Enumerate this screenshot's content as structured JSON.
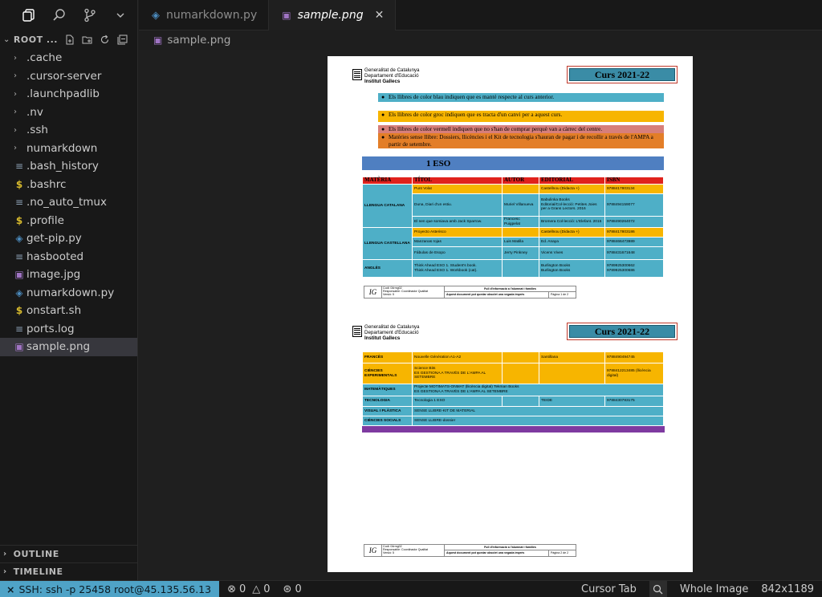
{
  "activity": {
    "icons": [
      "files-icon",
      "search-icon",
      "source-control-icon",
      "chevron-down-icon"
    ]
  },
  "explorer": {
    "title": "ROOT ...",
    "items": [
      {
        "name": ".cache",
        "type": "folder"
      },
      {
        "name": ".cursor-server",
        "type": "folder"
      },
      {
        "name": ".launchpadlib",
        "type": "folder"
      },
      {
        "name": ".nv",
        "type": "folder"
      },
      {
        "name": ".ssh",
        "type": "folder"
      },
      {
        "name": "numarkdown",
        "type": "folder"
      },
      {
        "name": ".bash_history",
        "type": "lines"
      },
      {
        "name": ".bashrc",
        "type": "dollar"
      },
      {
        "name": ".no_auto_tmux",
        "type": "lines"
      },
      {
        "name": ".profile",
        "type": "dollar"
      },
      {
        "name": "get-pip.py",
        "type": "python"
      },
      {
        "name": "hasbooted",
        "type": "lines"
      },
      {
        "name": "image.jpg",
        "type": "img"
      },
      {
        "name": "numarkdown.py",
        "type": "python"
      },
      {
        "name": "onstart.sh",
        "type": "dollar"
      },
      {
        "name": "ports.log",
        "type": "lines"
      },
      {
        "name": "sample.png",
        "type": "img",
        "selected": true
      }
    ],
    "outline": "OUTLINE",
    "timeline": "TIMELINE"
  },
  "tabs": [
    {
      "label": "numarkdown.py",
      "active": false
    },
    {
      "label": "sample.png",
      "active": true
    }
  ],
  "breadcrumb": "sample.png",
  "doc": {
    "gen1": "Generalitat de Catalunya",
    "gen2": "Departament d'Educació",
    "gen3": "Institut Gallecs",
    "curs": "Curs 2021-22",
    "bands": [
      "Els llibres de color blau indiquen que es manté respecte al curs anterior.",
      "Els llibres de color groc indiquen que es tracta d'un canvi per a aquest curs.",
      "Els llibres de color vermell indiquen que no s'han de comprar perquè van a càrrec del centre.",
      "Matèries sense llibre: Dossiers, llicències i el Kit de tecnologia s'hauran de pagar i de recollir a través de l'AMPA a partir de setembre."
    ],
    "eso": "1 ESO",
    "headers": [
      "MATÈRIA",
      "TÍTOL",
      "AUTOR",
      "EDITORIAL",
      "ISBN"
    ],
    "t1": {
      "catalana": "LLENGUA CATALANA",
      "c1": [
        "Punt Volat",
        "",
        "Castellnou (Didacta +)",
        "9788417803134"
      ],
      "c2": [
        "Duna, Diari d'un estiu.",
        "Muriel Villanueva",
        "Babulinka Books Editorial/Col·lecció: Petites Joies per a Grans Lectors. 2016",
        "9788494159077"
      ],
      "c3": [
        "El nen que somiava amb Jack Sparrow.",
        "Francesc Puigpelat",
        "Bromera Col·lecció: L'Elefant. 2015",
        "9788490264072"
      ],
      "castellana": "LLENGUA CASTELLANA",
      "s1": [
        "Proyecto Asterisco",
        "",
        "Castellnou (Didacta +)",
        "9788417803186"
      ],
      "s2": [
        "Manzanas rojas",
        "Luis Matilla",
        "Ed. Anaya",
        "9788466473989"
      ],
      "s3": [
        "Fábulas de Esopo",
        "Jerry Pinkney",
        "Vicens Vives",
        "9788431671648"
      ],
      "angles": "ANGLÈS",
      "a1": [
        "Think Ahead ESO 1. Student's book.",
        "Think Ahead ESO 1. Workbook (cat).",
        "",
        "Burlington Books",
        "Burlington Books",
        "9789925300662",
        "9789925300686"
      ]
    },
    "t2": {
      "r1": [
        "FRANCÈS",
        "Nouvelle Génération A1-A2",
        "",
        "Santillana",
        "9788490494745"
      ],
      "r2": [
        "CIÈNCIES EXPERIMENTALS",
        "Science Bits",
        "ES GESTIONA A TRAVÉS DE L'AMPA AL SETEMBRE",
        "",
        "",
        "9788412213485 (llicència digital)"
      ],
      "r3": [
        "MATEMÀTIQUES",
        "Projecte MOTIMATS-ONMAT (llicència digital) Tekman Books",
        "ES GESTIONA A TRAVÉS DE L'AMPA AL SETEMBRE"
      ],
      "r4": [
        "TECNOLOGIA",
        "Tecnologia 1 ESO",
        "",
        "TEIDE",
        "9788430783175"
      ],
      "r5": [
        "VISUAL I PLÀSTICA",
        "SENSE LLIBRE-KIT DE MATERIAL"
      ],
      "r6": [
        "CIÈNCIES SOCIALS",
        "SENSE LLIBRE-dossier"
      ]
    },
    "footer": {
      "logo": "IG",
      "codi": "Codi: 04rmg02",
      "resp": "Responsable: Coordinador Qualitat",
      "versio": "Versió: 5",
      "title": "Full d'informació a l'alumnat i famílies",
      "note": "Aquest document pot quedar obsolet una vegada imprès",
      "page1": "Pàgina 1 de 2",
      "page2": "Pàgina 2 de 2"
    }
  },
  "status": {
    "remote": "SSH: ssh -p 25458 root@45.135.56.13",
    "errors": "0",
    "warnings": "0",
    "ports": "0",
    "cursor_tab": "Cursor Tab",
    "whole_image": "Whole Image",
    "dims": "842x1189"
  }
}
